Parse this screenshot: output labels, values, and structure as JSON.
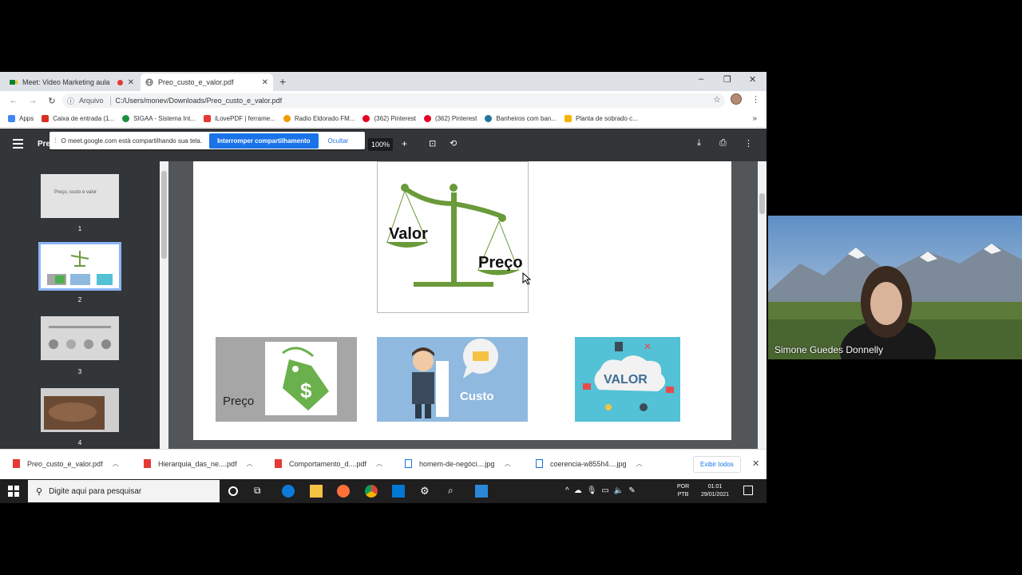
{
  "browser": {
    "tabs": [
      {
        "label": "Meet: Video Marketing aula",
        "active": false
      },
      {
        "label": "Preo_custo_e_valor.pdf",
        "active": true
      }
    ],
    "new_tab": "+",
    "window_controls": {
      "minimize": "–",
      "restore": "❐",
      "close": "✕"
    },
    "address": {
      "scheme_label": "Arquivo",
      "path": "C:/Users/monev/Downloads/Preo_custo_e_valor.pdf"
    },
    "bookmarks": [
      {
        "label": "Apps",
        "color": "#4285f4"
      },
      {
        "label": "Caixa de entrada (1...",
        "color": "#d93025"
      },
      {
        "label": "SIGAA - Sistema Int...",
        "color": "#1e8e3e"
      },
      {
        "label": "iLovePDF | ferrame...",
        "color": "#e53935"
      },
      {
        "label": "Radio Eldorado FM...",
        "color": "#f29900"
      },
      {
        "label": "(362) Pinterest",
        "color": "#e60023"
      },
      {
        "label": "(362) Pinterest",
        "color": "#e60023"
      },
      {
        "label": "Banheiros com ban...",
        "color": "#21759b"
      },
      {
        "label": "Planta de sobrado c...",
        "color": "#f4b400"
      }
    ],
    "bookmarks_more": "»"
  },
  "pdf_viewer": {
    "title_fragment": "Pre",
    "share_banner": {
      "message": "O meet.google.com está compartilhando sua tela.",
      "stop_label": "Interromper compartilhamento",
      "hide_label": "Ocultar"
    },
    "zoom": "100%",
    "zoom_in": "+",
    "thumbnails": [
      {
        "page": "1",
        "title": "Preço, custo e valor"
      },
      {
        "page": "2",
        "title": ""
      },
      {
        "page": "3",
        "title": ""
      },
      {
        "page": "4",
        "title": ""
      }
    ],
    "selected_page": "2",
    "slide": {
      "scale_left_word": "Valor",
      "scale_right_word": "Preço",
      "image_preco_word": "Preço",
      "image_custo_word": "Custo",
      "image_valor_word": "VALOR"
    }
  },
  "downloads": [
    {
      "file": "Preo_custo_e_valor.pdf",
      "kind": "pdf"
    },
    {
      "file": "Hierarquia_das_ne....pdf",
      "kind": "pdf"
    },
    {
      "file": "Comportamento_d....pdf",
      "kind": "pdf"
    },
    {
      "file": "homem-de-negóci....jpg",
      "kind": "jpg"
    },
    {
      "file": "coerencia-w855h4....jpg",
      "kind": "jpg"
    }
  ],
  "downloads_show_all": "Exibir todos",
  "taskbar": {
    "search_placeholder": "Digite aqui para pesquisar",
    "lang_top": "POR",
    "lang_bottom": "PTB",
    "time": "01:01",
    "date": "29/01/2021"
  },
  "webcam": {
    "participant_name": "Simone Guedes Donnelly"
  },
  "colors": {
    "accent": "#1a73e8",
    "pdf_toolbar": "#323639",
    "scale_green": "#6a9a3a"
  }
}
